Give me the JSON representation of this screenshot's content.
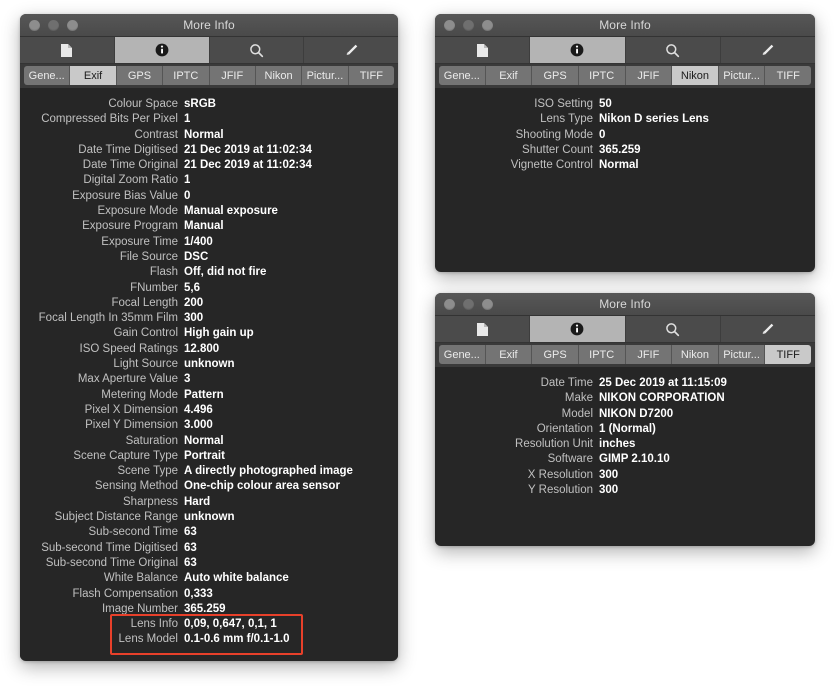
{
  "window_title": "More Info",
  "toolbar_icons": [
    {
      "name": "document-icon",
      "active": false
    },
    {
      "name": "info-icon",
      "active": true
    },
    {
      "name": "search-icon",
      "active": false
    },
    {
      "name": "pencil-icon",
      "active": false
    }
  ],
  "tabs": [
    "Gene...",
    "Exif",
    "GPS",
    "IPTC",
    "JFIF",
    "Nikon",
    "Pictur...",
    "TIFF"
  ],
  "colors": {
    "window_background": "#262626",
    "titlebar": "#4f4f4f",
    "toolbar": "#4b4b4b",
    "tab_inactive": "#747474",
    "tab_active": "#c9c9c9",
    "label_text": "#c0c0c0",
    "value_text": "#ffffff",
    "annotation": "#e8402a",
    "page_background": "#ffffff"
  },
  "windows": [
    {
      "id": "window-exif",
      "title": "More Info",
      "active_tab": "Exif",
      "rows": [
        {
          "label": "Colour Space",
          "value": "sRGB"
        },
        {
          "label": "Compressed Bits Per Pixel",
          "value": "1"
        },
        {
          "label": "Contrast",
          "value": "Normal"
        },
        {
          "label": "Date Time Digitised",
          "value": "21 Dec 2019 at 11:02:34"
        },
        {
          "label": "Date Time Original",
          "value": "21 Dec 2019 at 11:02:34"
        },
        {
          "label": "Digital Zoom Ratio",
          "value": "1"
        },
        {
          "label": "Exposure Bias Value",
          "value": "0"
        },
        {
          "label": "Exposure Mode",
          "value": "Manual exposure"
        },
        {
          "label": "Exposure Program",
          "value": "Manual"
        },
        {
          "label": "Exposure Time",
          "value": "1/400"
        },
        {
          "label": "File Source",
          "value": "DSC"
        },
        {
          "label": "Flash",
          "value": "Off, did not fire"
        },
        {
          "label": "FNumber",
          "value": "5,6"
        },
        {
          "label": "Focal Length",
          "value": "200"
        },
        {
          "label": "Focal Length In 35mm Film",
          "value": "300"
        },
        {
          "label": "Gain Control",
          "value": "High gain up"
        },
        {
          "label": "ISO Speed Ratings",
          "value": "12.800"
        },
        {
          "label": "Light Source",
          "value": "unknown"
        },
        {
          "label": "Max Aperture Value",
          "value": "3"
        },
        {
          "label": "Metering Mode",
          "value": "Pattern"
        },
        {
          "label": "Pixel X Dimension",
          "value": "4.496"
        },
        {
          "label": "Pixel Y Dimension",
          "value": "3.000"
        },
        {
          "label": "Saturation",
          "value": "Normal"
        },
        {
          "label": "Scene Capture Type",
          "value": "Portrait"
        },
        {
          "label": "Scene Type",
          "value": "A directly photographed image"
        },
        {
          "label": "Sensing Method",
          "value": "One-chip colour area sensor"
        },
        {
          "label": "Sharpness",
          "value": "Hard"
        },
        {
          "label": "Subject Distance Range",
          "value": "unknown"
        },
        {
          "label": "Sub-second Time",
          "value": "63"
        },
        {
          "label": "Sub-second Time Digitised",
          "value": "63"
        },
        {
          "label": "Sub-second Time Original",
          "value": "63"
        },
        {
          "label": "White Balance",
          "value": "Auto white balance"
        },
        {
          "label": "Flash Compensation",
          "value": "0,333"
        },
        {
          "label": "Image Number",
          "value": "365.259"
        },
        {
          "label": "Lens Info",
          "value": "0,09, 0,647, 0,1, 1"
        },
        {
          "label": "Lens Model",
          "value": "0.1-0.6 mm f/0.1-1.0"
        }
      ]
    },
    {
      "id": "window-nikon",
      "title": "More Info",
      "active_tab": "Nikon",
      "rows": [
        {
          "label": "ISO Setting",
          "value": "50"
        },
        {
          "label": "Lens Type",
          "value": "Nikon D series Lens"
        },
        {
          "label": "Shooting Mode",
          "value": "0"
        },
        {
          "label": "Shutter Count",
          "value": "365.259"
        },
        {
          "label": "Vignette Control",
          "value": "Normal"
        }
      ]
    },
    {
      "id": "window-tiff",
      "title": "More Info",
      "active_tab": "TIFF",
      "rows": [
        {
          "label": "Date Time",
          "value": "25 Dec 2019 at 11:15:09"
        },
        {
          "label": "Make",
          "value": "NIKON CORPORATION"
        },
        {
          "label": "Model",
          "value": "NIKON D7200"
        },
        {
          "label": "Orientation",
          "value": "1 (Normal)"
        },
        {
          "label": "Resolution Unit",
          "value": "inches"
        },
        {
          "label": "Software",
          "value": "GIMP 2.10.10"
        },
        {
          "label": "X Resolution",
          "value": "300"
        },
        {
          "label": "Y Resolution",
          "value": "300"
        }
      ]
    }
  ],
  "annotations": [
    {
      "name": "lens-info-highlight",
      "target_labels": [
        "Lens Info",
        "Lens Model"
      ],
      "color": "#e8402a"
    }
  ]
}
